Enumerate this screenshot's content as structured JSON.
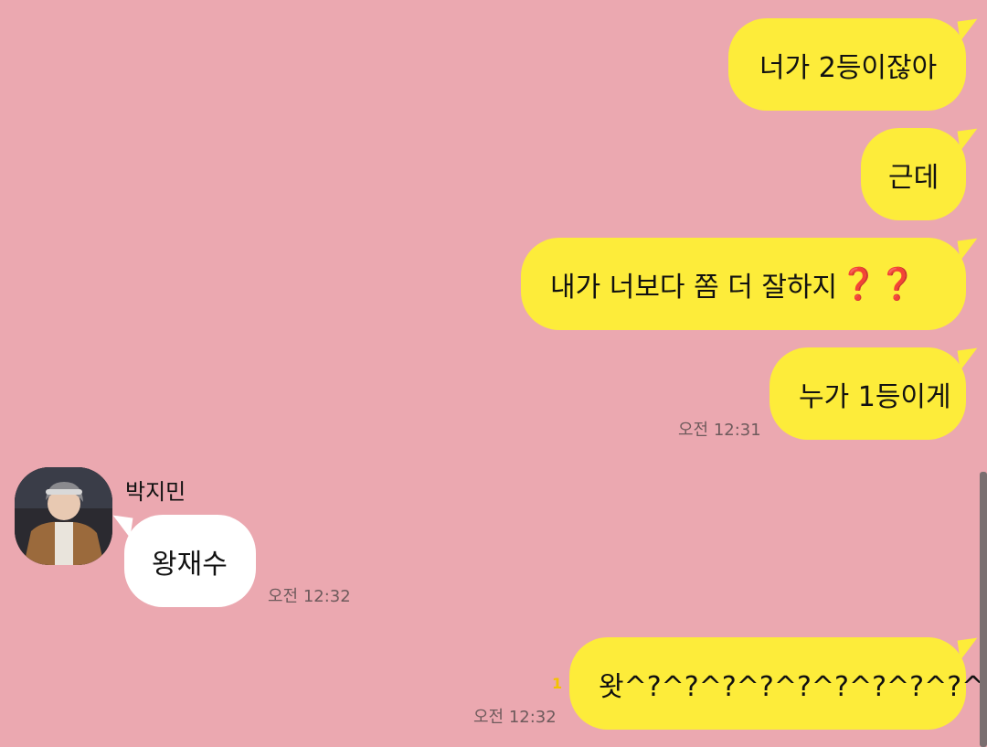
{
  "chat": {
    "messages": [
      {
        "text": "너가 2등이잖아"
      },
      {
        "text": "근데"
      },
      {
        "text": "내가 너보다 쫌 더 잘하지",
        "emoji": "❓❓"
      },
      {
        "text": "누가 1등이게",
        "time": "오전 12:31"
      },
      {
        "sender": "박지민",
        "text": "왕재수",
        "time": "오전 12:32"
      },
      {
        "text": "왓^?^?^?^?^?^?^?^?^?^",
        "unread": "1",
        "time": "오전 12:32"
      }
    ]
  },
  "colors": {
    "background": "#eba8b0",
    "outgoing_bubble": "#fdec3a",
    "incoming_bubble": "#ffffff",
    "question_emoji": "#e0232d",
    "unread_count": "#f3c200"
  }
}
